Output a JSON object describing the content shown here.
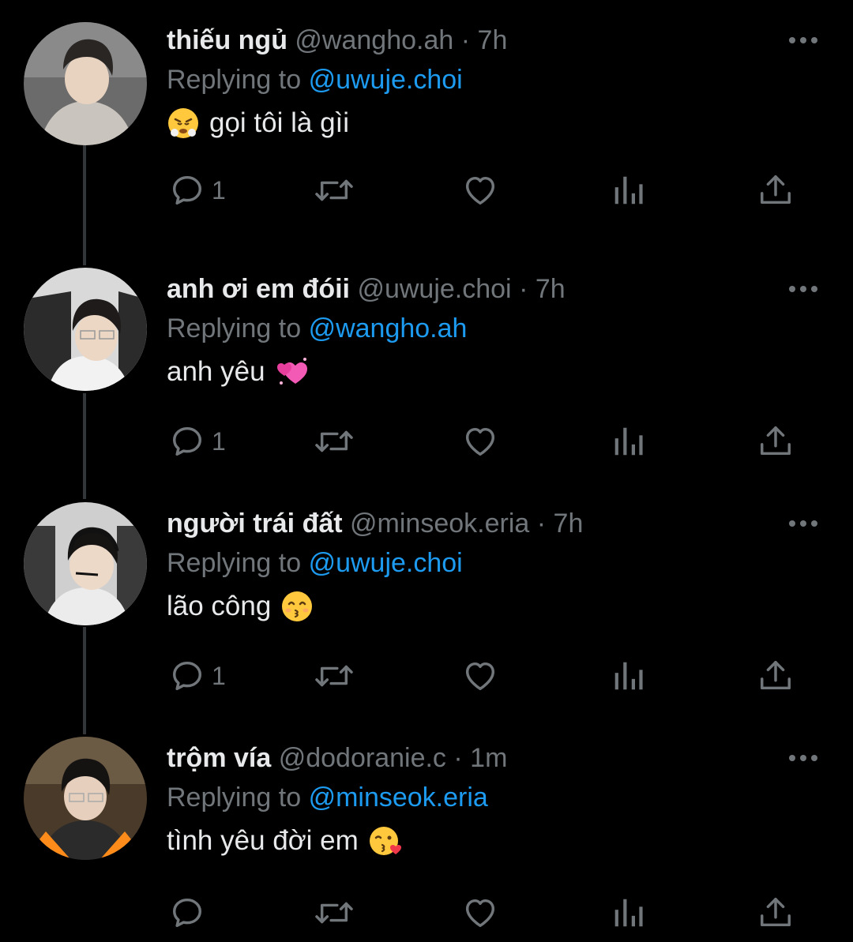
{
  "tweets": [
    {
      "display_name": "thiếu ngủ",
      "handle": "@wangho.ah",
      "separator": "·",
      "time": "7h",
      "replying_prefix": "Replying to",
      "replying_to": "@uwuje.choi",
      "text": "gọi tôi là gìi",
      "emoji": "face-with-steam-from-nose",
      "reply_count": "1"
    },
    {
      "display_name": "anh ơi em đóii",
      "handle": "@uwuje.choi",
      "separator": "·",
      "time": "7h",
      "replying_prefix": "Replying to",
      "replying_to": "@wangho.ah",
      "text": "anh yêu",
      "emoji": "revolving-hearts",
      "reply_count": "1"
    },
    {
      "display_name": "người trái đất",
      "handle": "@minseok.eria",
      "separator": "·",
      "time": "7h",
      "replying_prefix": "Replying to",
      "replying_to": "@uwuje.choi",
      "text": "lão công",
      "emoji": "kissing-face-with-smiling-eyes",
      "reply_count": "1"
    },
    {
      "display_name": "trộm vía",
      "handle": "@dodoranie.c",
      "separator": "·",
      "time": "1m",
      "replying_prefix": "Replying to",
      "replying_to": "@minseok.eria",
      "text": "tình yêu đời em",
      "emoji": "face-blowing-a-kiss",
      "reply_count": ""
    }
  ],
  "icons": {
    "reply": "speech-bubble-icon",
    "retweet": "retweet-arrows-icon",
    "like": "heart-icon",
    "views": "bar-chart-icon",
    "share": "share-upload-icon",
    "more": "ellipsis-icon"
  },
  "colors": {
    "background": "#000000",
    "primary_text": "#e7e9ea",
    "secondary_text": "#71767b",
    "link": "#1d9bf0",
    "thread_line": "#333639"
  }
}
